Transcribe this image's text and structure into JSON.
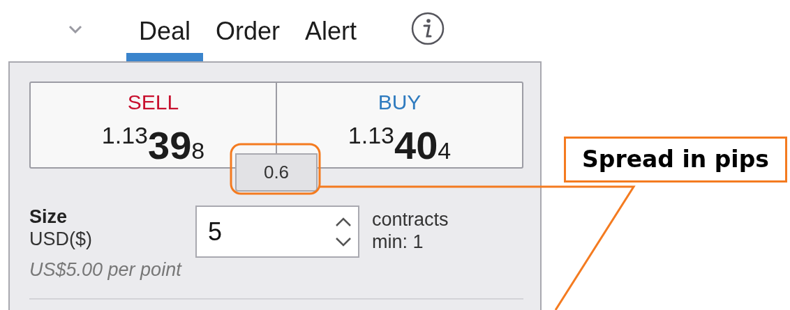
{
  "tabs": [
    {
      "label": "Deal",
      "selected": true
    },
    {
      "label": "Order",
      "selected": false
    },
    {
      "label": "Alert",
      "selected": false
    }
  ],
  "quotes": [
    {
      "kind": "sell",
      "label": "SELL",
      "price_prefix": "1.13",
      "price_pips": "39",
      "price_fraction": "8"
    },
    {
      "kind": "buy",
      "label": "BUY",
      "price_prefix": "1.13",
      "price_pips": "40",
      "price_fraction": "4"
    }
  ],
  "spread": "0.6",
  "size": {
    "label": "Size",
    "currency": "USD($)",
    "value": "5",
    "unit": "contracts",
    "minimum": "min: 1",
    "per_point": "US$5.00 per point"
  },
  "annotation": {
    "label": "Spread in pips"
  }
}
